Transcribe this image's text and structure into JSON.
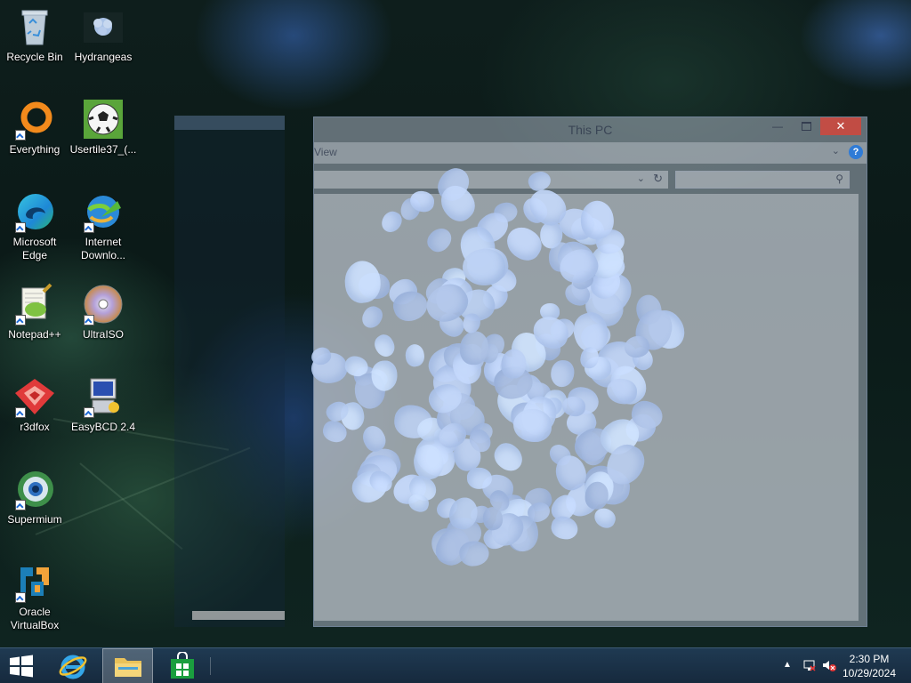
{
  "desktop": {
    "icons": [
      {
        "label": "Recycle Bin",
        "icon": "recycle-bin-icon"
      },
      {
        "label": "Hydrangeas",
        "icon": "image-file-icon"
      },
      {
        "label": "Everything",
        "icon": "everything-search-icon"
      },
      {
        "label": "Usertile37_(...",
        "icon": "soccer-ball-image-icon"
      },
      {
        "label": "Microsoft Edge",
        "icon": "edge-browser-icon"
      },
      {
        "label": "Internet Downlo...",
        "icon": "internet-download-manager-icon"
      },
      {
        "label": "Notepad++",
        "icon": "notepad-plus-plus-icon"
      },
      {
        "label": "UltraISO",
        "icon": "ultraiso-disc-icon"
      },
      {
        "label": "r3dfox",
        "icon": "r3dfox-browser-icon"
      },
      {
        "label": "EasyBCD 2.4",
        "icon": "easybcd-icon"
      },
      {
        "label": "Supermium",
        "icon": "supermium-browser-icon"
      },
      {
        "label": "Oracle VirtualBox",
        "icon": "virtualbox-icon"
      }
    ]
  },
  "explorer_window": {
    "title": "This PC",
    "ribbon_tab": "View",
    "help_label": "?",
    "colors": {
      "close_button": "#d2463c",
      "help": "#2f7bd6"
    }
  },
  "taskbar": {
    "buttons": [
      {
        "name": "start-button",
        "icon": "windows-logo-icon"
      },
      {
        "name": "internet-explorer-button",
        "icon": "internet-explorer-icon"
      },
      {
        "name": "file-explorer-button",
        "icon": "folder-icon",
        "active": true
      },
      {
        "name": "store-button",
        "icon": "store-bag-icon"
      }
    ],
    "tray": {
      "time": "2:30 PM",
      "date": "10/29/2024"
    }
  }
}
